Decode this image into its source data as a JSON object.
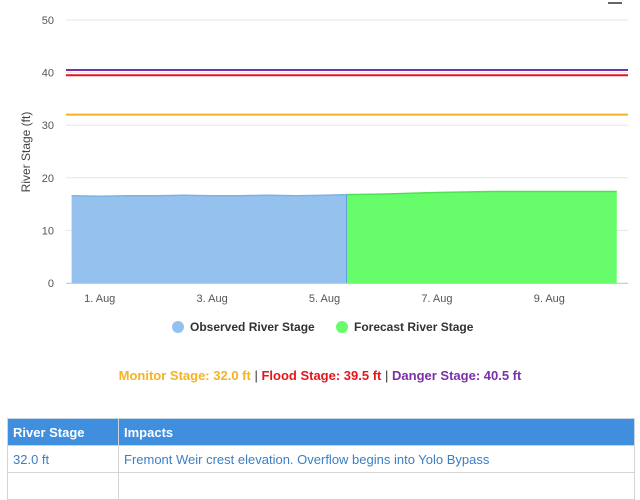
{
  "chart_data": {
    "type": "area",
    "ylabel": "River Stage (ft)",
    "ylim": [
      0,
      50
    ],
    "y_ticks": [
      0,
      10,
      20,
      30,
      40,
      50
    ],
    "x_range_days": [
      0.4,
      10.4
    ],
    "x_ticks": [
      {
        "day": 1,
        "label": "1. Aug"
      },
      {
        "day": 3,
        "label": "3. Aug"
      },
      {
        "day": 5,
        "label": "5. Aug"
      },
      {
        "day": 7,
        "label": "7. Aug"
      },
      {
        "day": 9,
        "label": "9. Aug"
      }
    ],
    "series": [
      {
        "name": "Observed River Stage",
        "color": "#94c1ee",
        "points": [
          [
            0.5,
            16.6
          ],
          [
            1.0,
            16.5
          ],
          [
            1.5,
            16.6
          ],
          [
            2.0,
            16.6
          ],
          [
            2.5,
            16.7
          ],
          [
            3.0,
            16.6
          ],
          [
            3.5,
            16.6
          ],
          [
            4.0,
            16.7
          ],
          [
            4.5,
            16.6
          ],
          [
            5.0,
            16.7
          ],
          [
            5.4,
            16.8
          ]
        ]
      },
      {
        "name": "Forecast River Stage",
        "color": "#67fd6a",
        "points": [
          [
            5.4,
            16.8
          ],
          [
            6.0,
            16.9
          ],
          [
            7.0,
            17.2
          ],
          [
            8.0,
            17.4
          ],
          [
            9.0,
            17.4
          ],
          [
            10.2,
            17.4
          ]
        ]
      }
    ],
    "thresholds": [
      {
        "name": "Monitor Stage",
        "value": 32.0,
        "color": "#f5b223"
      },
      {
        "name": "Flood Stage",
        "value": 39.5,
        "color": "#e8141b"
      },
      {
        "name": "Danger Stage",
        "value": 40.5,
        "color": "#7b2fa8"
      }
    ],
    "legend_position": "bottom-center",
    "grid": true
  },
  "stages_text": {
    "monitor": "Monitor Stage: 32.0 ft",
    "sep1": "|",
    "flood": "Flood Stage: 39.5 ft",
    "sep2": "|",
    "danger": "Danger Stage: 40.5 ft"
  },
  "impacts_table": {
    "headers": [
      "River Stage",
      "Impacts"
    ],
    "rows": [
      [
        "32.0 ft",
        "Fremont Weir crest elevation. Overflow begins into Yolo Bypass"
      ],
      [
        "",
        ""
      ]
    ]
  }
}
